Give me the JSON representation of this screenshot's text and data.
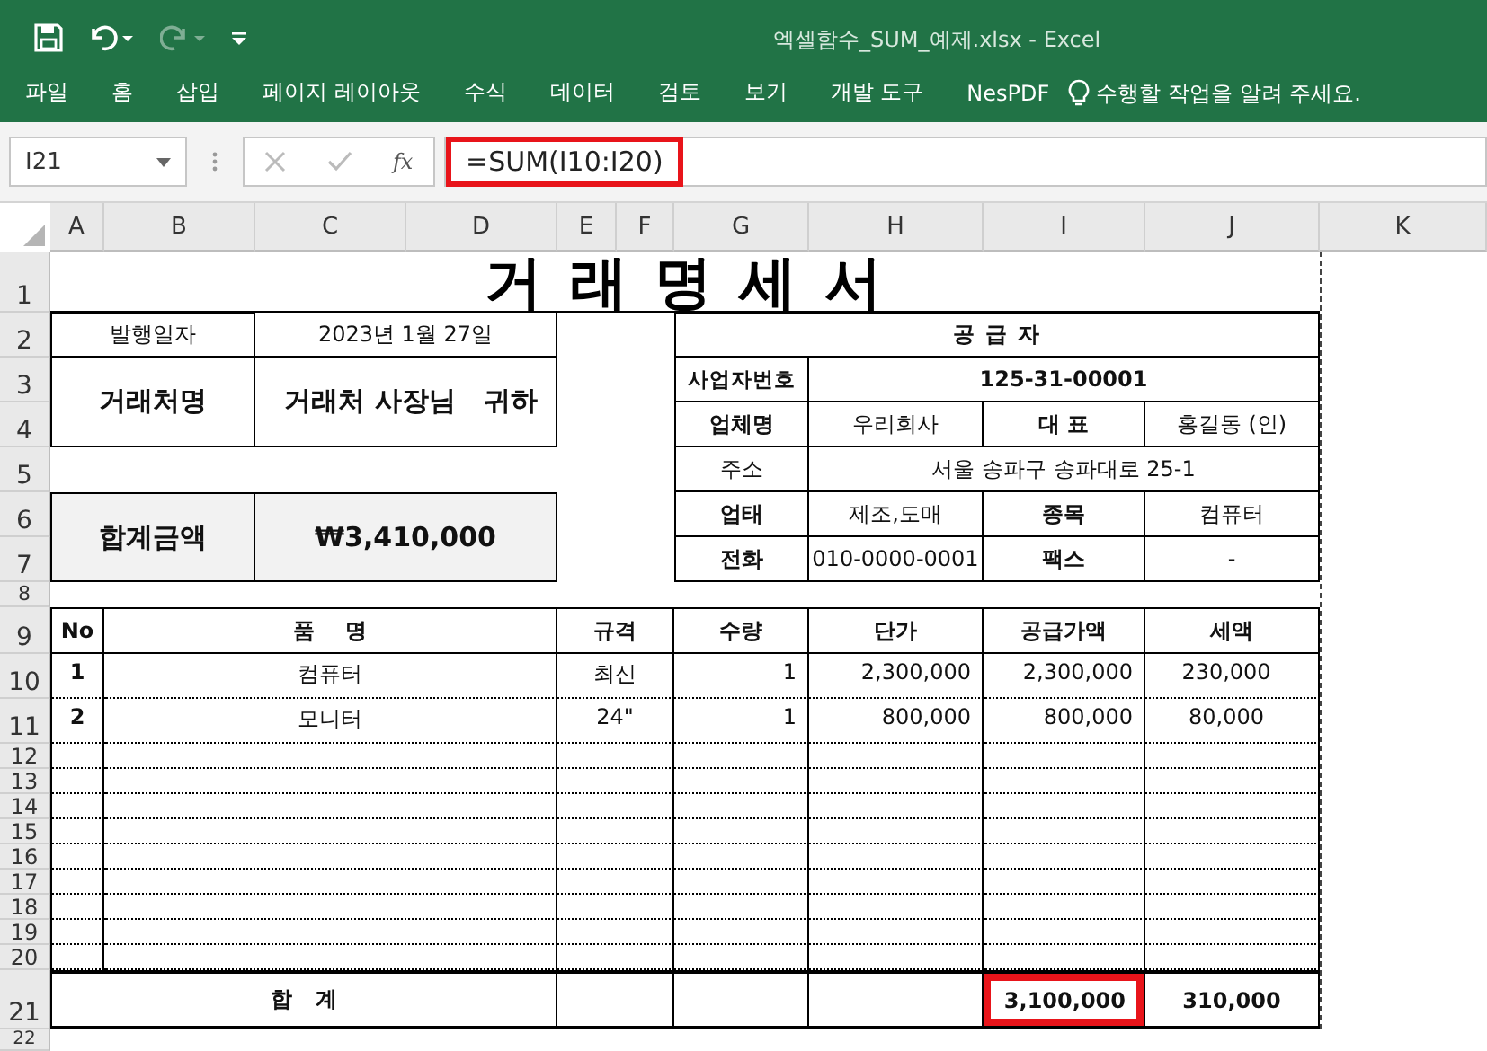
{
  "window": {
    "title": "엑셀함수_SUM_예제.xlsx - Excel"
  },
  "quick_access": [
    {
      "kind": "save",
      "disabled": false
    },
    {
      "kind": "undo",
      "disabled": false
    },
    {
      "kind": "redo",
      "disabled": true
    },
    {
      "kind": "customize",
      "disabled": false
    }
  ],
  "ribbon_tabs": [
    {
      "label": "파일"
    },
    {
      "label": "홈"
    },
    {
      "label": "삽입"
    },
    {
      "label": "페이지 레이아웃"
    },
    {
      "label": "수식"
    },
    {
      "label": "데이터"
    },
    {
      "label": "검토"
    },
    {
      "label": "보기"
    },
    {
      "label": "개발 도구"
    },
    {
      "label": "NesPDF"
    }
  ],
  "tell_me": {
    "placeholder": "수행할 작업을 알려 주세요."
  },
  "formula_bar": {
    "name_box": "I21",
    "function_label": "fx",
    "formula": "=SUM(I10:I20)",
    "highlighted": true
  },
  "columns": [
    "A",
    "B",
    "C",
    "D",
    "E",
    "F",
    "G",
    "H",
    "I",
    "J",
    "K"
  ],
  "row_numbers": [
    "1",
    "2",
    "3",
    "4",
    "5",
    "6",
    "7",
    "8",
    "9",
    "10",
    "11",
    "12",
    "13",
    "14",
    "15",
    "16",
    "17",
    "18",
    "19",
    "20",
    "21",
    "22"
  ],
  "invoice": {
    "title": "거 래 명 세 서",
    "issue_date_label": "발행일자",
    "issue_date": "2023년 1월 27일",
    "client_label": "거래처명",
    "client_name": "거래처 사장님   귀하",
    "total_label": "합계금액",
    "total_amount": "₩3,410,000",
    "supplier": {
      "heading": "공 급 자",
      "business_number_label": "사업자번호",
      "business_number": "125-31-00001",
      "company_label": "업체명",
      "company": "우리회사",
      "ceo_label": "대 표",
      "ceo": "홍길동  (인)",
      "address_label": "주소",
      "address": "서울 송파구 송파대로 25-1",
      "business_type_label": "업태",
      "business_type": "제조,도매",
      "category_label": "종목",
      "category": "컴퓨터",
      "phone_label": "전화",
      "phone": "010-0000-0001",
      "fax_label": "팩스",
      "fax": "-"
    },
    "item_columns": [
      "No",
      "품    명",
      "규격",
      "수량",
      "단가",
      "공급가액",
      "세액"
    ],
    "items": [
      {
        "no": "1",
        "name": "컴퓨터",
        "spec": "최신",
        "qty": "1",
        "price": "2,300,000",
        "supply": "2,300,000",
        "tax": "230,000"
      },
      {
        "no": "2",
        "name": "모니터",
        "spec": "24\"",
        "qty": "1",
        "price": "800,000",
        "supply": "800,000",
        "tax": "80,000"
      }
    ],
    "totals": {
      "label": "합   계",
      "supply": "3,100,000",
      "tax": "310,000",
      "supply_highlighted": true
    }
  }
}
